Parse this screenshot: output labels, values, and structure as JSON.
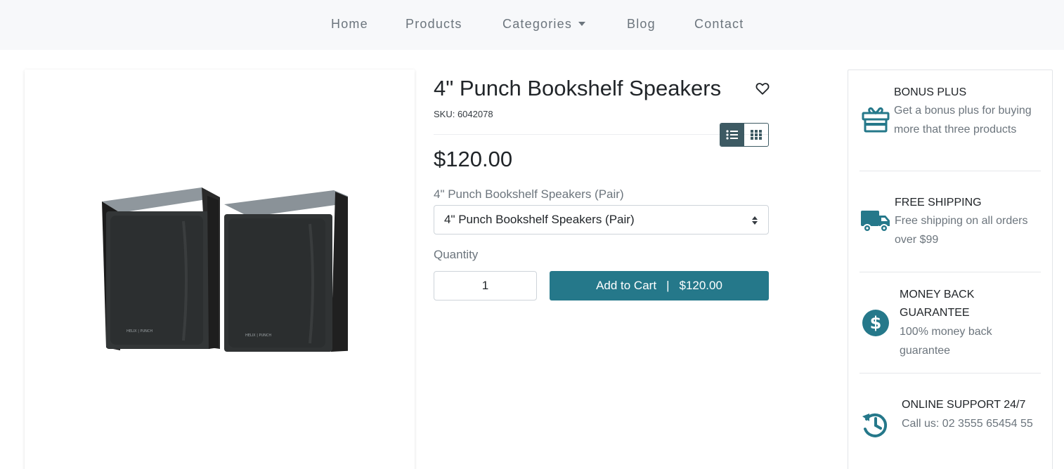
{
  "nav": {
    "items": [
      {
        "label": "Home"
      },
      {
        "label": "Products"
      },
      {
        "label": "Categories"
      },
      {
        "label": "Blog"
      },
      {
        "label": "Contact"
      }
    ]
  },
  "product": {
    "title": "4\" Punch Bookshelf Speakers",
    "sku": "SKU: 6042078",
    "price": "$120.00",
    "image_brand_text": "HELIX | PUNCH",
    "variant_label": "4\" Punch Bookshelf Speakers (Pair)",
    "variant_selected": "4\" Punch Bookshelf Speakers (Pair)",
    "quantity_label": "Quantity",
    "quantity_value": "1",
    "add_to_cart_label": "Add to Cart",
    "add_to_cart_separator": "|",
    "add_to_cart_price": "$120.00"
  },
  "icons": {
    "wishlist": "heart-icon",
    "list_view": "list-icon",
    "grid_view": "grid-icon",
    "categories_dropdown": "caret-down-icon",
    "select": "sort-arrows-icon"
  },
  "benefits": [
    {
      "icon": "gift-icon",
      "title": "BONUS PLUS",
      "text": "Get a bonus plus for buying more that three products"
    },
    {
      "icon": "truck-icon",
      "title": "FREE SHIPPING",
      "text": "Free shipping on all orders over $99"
    },
    {
      "icon": "dollar-circle-icon",
      "title": "MONEY BACK GUARANTEE",
      "text": "100% money back guarantee"
    },
    {
      "icon": "history-icon",
      "title": "ONLINE SUPPORT 24/7",
      "text": "Call us: 02 3555 65454 55"
    }
  ],
  "colors": {
    "accent": "#25788a",
    "toggle_active": "#3d5a63",
    "nav_background": "#f7f8fa",
    "nav_text": "#6c757d"
  }
}
